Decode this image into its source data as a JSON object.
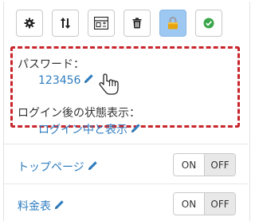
{
  "toolbar": {
    "buttons": [
      {
        "name": "settings",
        "icon": "gear-icon"
      },
      {
        "name": "sort",
        "icon": "sort-arrows-icon"
      },
      {
        "name": "layout",
        "icon": "layout-add-icon"
      },
      {
        "name": "delete",
        "icon": "trash-icon"
      },
      {
        "name": "lock",
        "icon": "lock-icon",
        "active": true
      },
      {
        "name": "confirm",
        "icon": "check-circle-icon"
      }
    ]
  },
  "password": {
    "label": "パスワード：",
    "value": "123456",
    "edit_icon": "pencil-icon"
  },
  "login_state": {
    "label": "ログイン後の状態表示：",
    "value": "ログイン中と表示",
    "edit_icon": "pencil-icon"
  },
  "rows": [
    {
      "label": "トップページ",
      "on": "ON",
      "off": "OFF",
      "selected": "OFF"
    },
    {
      "label": "料金表",
      "on": "ON",
      "off": "OFF",
      "selected": "OFF"
    }
  ],
  "colors": {
    "link": "#2f7dbf",
    "highlight_border": "#c8262d",
    "active_button": "#9cc8f2",
    "check": "#3aa64b",
    "lock": "#e8a40c"
  }
}
